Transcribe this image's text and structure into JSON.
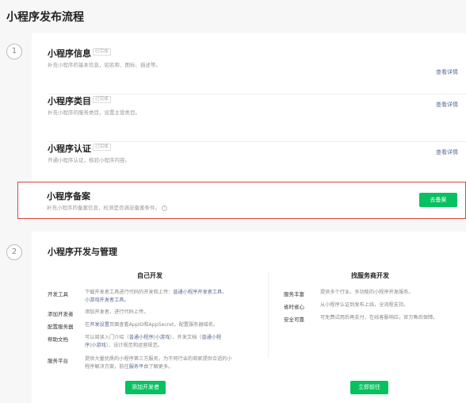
{
  "page_title": "小程序发布流程",
  "step1_num": "1",
  "step2_num": "2",
  "sections": [
    {
      "title": "小程序信息",
      "tag": "已完成",
      "desc": "补充小程序的基本信息，如名称、图标、描述等。",
      "link": "查看详情"
    },
    {
      "title": "小程序类目",
      "tag": "已完成",
      "desc": "补充小程序的服务类目，设置主营类目。",
      "link": "查看详情"
    },
    {
      "title": "小程序认证",
      "tag": "已完成",
      "desc": "开通小程序认证，核验小程序内容。",
      "link": "查看详情"
    }
  ],
  "filing": {
    "title": "小程序备案",
    "desc": "补充小程序的备案信息，检测是否满足备案条件。",
    "info_icon": "!",
    "button": "去备案"
  },
  "dev": {
    "title": "小程序开发与管理",
    "self_dev": {
      "heading": "自己开发",
      "rows": [
        {
          "label": "开发工具",
          "text_a": "下载开发者工具进行代码的开发和上传：",
          "link_a": "普通小程序开发者工具、",
          "link_b": "小游戏开发者工具。"
        },
        {
          "label": "添加开发者",
          "text_a": "添加开发者，进行代码上传。"
        },
        {
          "label": "配置服务器",
          "text_a": "在",
          "link_a": "开发设置",
          "text_b": "页面查看AppID和AppSecret，配置服务器域名。"
        },
        {
          "label": "帮助文档",
          "text_a": "可以阅读入门介绍（",
          "link_a": "普通小程序",
          "sep1": "|",
          "link_b": "小游戏",
          "text_b": "）、开发文档（",
          "link_c": "普通小程",
          "link_d": "序",
          "sep2": "|",
          "link_e": "小游戏",
          "text_c": "）、设计规范和运营规范。"
        },
        {
          "label": "服务平台",
          "text_a": "提供大量优质的小程序第三方服务，为不同行业的商家提供合适的小",
          "text_b": "程序解决方案，前往",
          "link_a": "服务平台",
          "text_c": "了解更多。"
        }
      ],
      "button": "添加开发者"
    },
    "vendor": {
      "heading": "找服务商开发",
      "rows": [
        {
          "label": "服务丰富",
          "text": "提供多个行业、多功能的小程序开发服务。"
        },
        {
          "label": "省时省心",
          "text": "从小程序认证到发布上线，全流程支持。"
        },
        {
          "label": "安全可靠",
          "text": "可免费试用后再支付，在线客服响应，官方售后保障。"
        }
      ],
      "button": "立即前往"
    }
  },
  "colors": {
    "accent_green": "#07c160",
    "link_blue": "#576b95",
    "highlight_red": "#e0433a"
  }
}
